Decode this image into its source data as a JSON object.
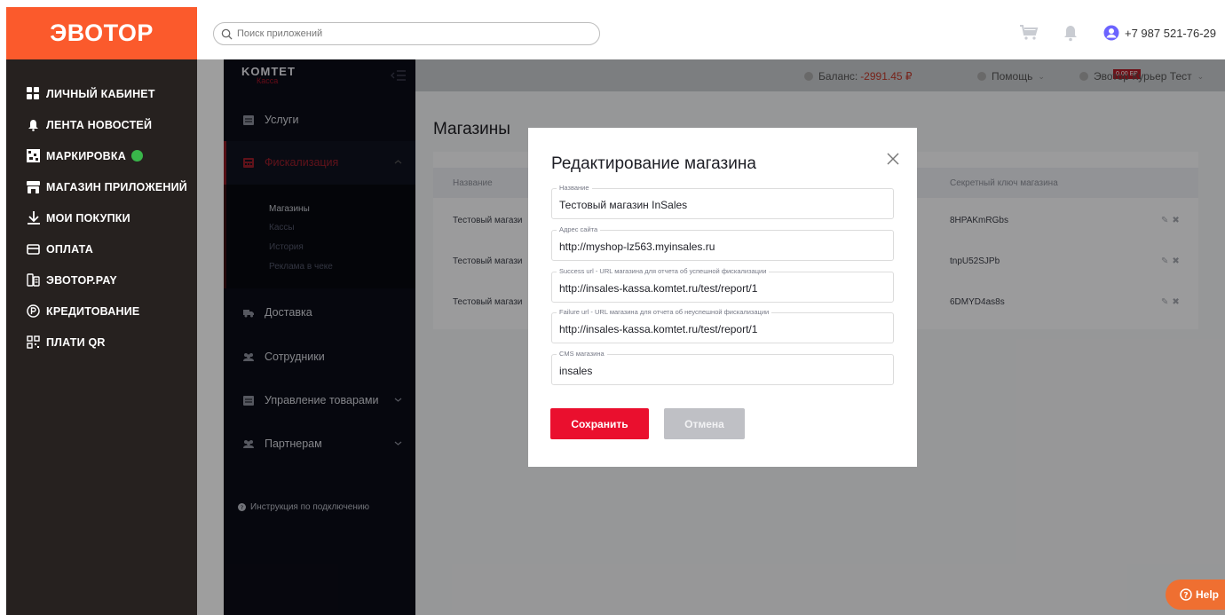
{
  "topbar": {
    "logo": "ЭВОТОР",
    "search_placeholder": "Поиск приложений",
    "account_phone": "+7 987 521-76-29"
  },
  "left_nav": {
    "items": [
      {
        "label": "ЛИЧНЫЙ КАБИНЕТ",
        "icon": "grid-icon"
      },
      {
        "label": "ЛЕНТА НОВОСТЕЙ",
        "icon": "bell-icon"
      },
      {
        "label": "МАРКИРОВКА",
        "icon": "qr-code-icon"
      },
      {
        "label": "МАГАЗИН ПРИЛОЖЕНИЙ",
        "icon": "store-icon"
      },
      {
        "label": "МОИ ПОКУПКИ",
        "icon": "download-icon"
      },
      {
        "label": "ОПЛАТА",
        "icon": "card-icon"
      },
      {
        "label": "ЭВОТОР.PAY",
        "icon": "terminal-icon"
      },
      {
        "label": "КРЕДИТОВАНИЕ",
        "icon": "ruble-circle-icon"
      },
      {
        "label": "ПЛАТИ QR",
        "icon": "qr-pay-icon"
      }
    ]
  },
  "app": {
    "brand_top": "KOMTET",
    "brand_sub": "Касса",
    "sidebar": {
      "services": "Услуги",
      "fiscalization": "Фискализация",
      "sub_items": [
        "Магазины",
        "Кассы",
        "История",
        "Реклама в чеке"
      ],
      "delivery": "Доставка",
      "employees": "Сотрудники",
      "goods": "Управление товарами",
      "partners": "Партнерам",
      "instruction": "Инструкция по подключению"
    },
    "header": {
      "balance_label": "Баланс:",
      "balance_value": "-2991.45 ₽",
      "bp_badge": "0.00 БР",
      "help": "Помощь",
      "user": "Эвотор Курьер Тест"
    },
    "page_title": "Магазины",
    "table": {
      "columns": [
        "Название",
        "Секретный ключ магазина"
      ],
      "rows": [
        {
          "name": "Тестовый магази",
          "secret": "8HPAKmRGbs"
        },
        {
          "name": "Тестовый магази",
          "secret": "tnpU52SJPb"
        },
        {
          "name": "Тестовый магази",
          "secret": "6DMYD4as8s"
        }
      ]
    }
  },
  "modal": {
    "title": "Редактирование магазина",
    "fields": [
      {
        "label": "Название",
        "value": "Тестовый магазин InSales"
      },
      {
        "label": "Адрес сайта",
        "value": "http://myshop-lz563.myinsales.ru"
      },
      {
        "label": "Success url - URL магазина для отчета об успешной фискализации",
        "value": "http://insales-kassa.komtet.ru/test/report/1"
      },
      {
        "label": "Failure url - URL магазина для отчета об неуспешной фискализации",
        "value": "http://insales-kassa.komtet.ru/test/report/1"
      },
      {
        "label": "CMS магазина",
        "value": "insales"
      }
    ],
    "save_label": "Сохранить",
    "cancel_label": "Отмена"
  },
  "help_label": "Help",
  "colors": {
    "brand_orange": "#fb5a2c",
    "save_red": "#ea0f2e",
    "nav_dark": "#26211f",
    "app_sidebar": "#0b0c17",
    "help_orange": "#ef6f31"
  }
}
